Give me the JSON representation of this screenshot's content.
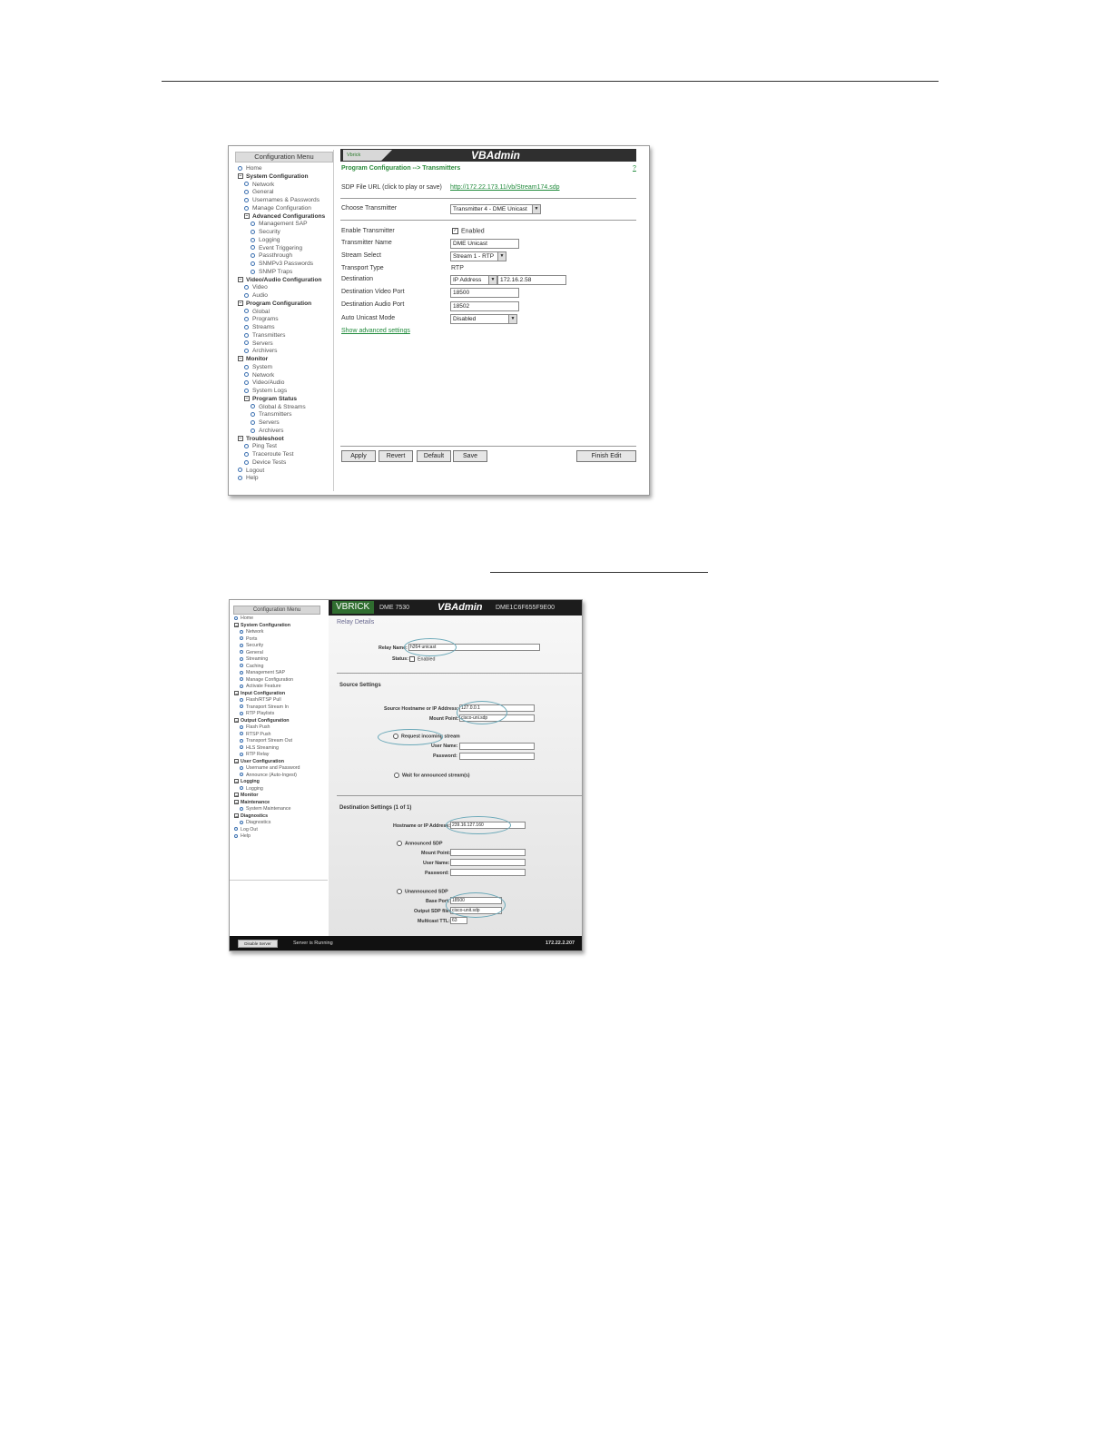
{
  "screen1": {
    "menu_title": "Configuration Menu",
    "menu": [
      {
        "label": "Home",
        "level": 0,
        "bold": false
      },
      {
        "label": "System Configuration",
        "level": 0,
        "bold": true
      },
      {
        "label": "Network",
        "level": 1,
        "bold": false
      },
      {
        "label": "General",
        "level": 1,
        "bold": false
      },
      {
        "label": "Usernames & Passwords",
        "level": 1,
        "bold": false
      },
      {
        "label": "Manage Configuration",
        "level": 1,
        "bold": false
      },
      {
        "label": "Advanced Configurations",
        "level": 1,
        "bold": true
      },
      {
        "label": "Management SAP",
        "level": 2,
        "bold": false
      },
      {
        "label": "Security",
        "level": 2,
        "bold": false
      },
      {
        "label": "Logging",
        "level": 2,
        "bold": false
      },
      {
        "label": "Event Triggering",
        "level": 2,
        "bold": false
      },
      {
        "label": "Passthrough",
        "level": 2,
        "bold": false
      },
      {
        "label": "SNMPv3 Passwords",
        "level": 2,
        "bold": false
      },
      {
        "label": "SNMP Traps",
        "level": 2,
        "bold": false
      },
      {
        "label": "Video/Audio Configuration",
        "level": 0,
        "bold": true
      },
      {
        "label": "Video",
        "level": 1,
        "bold": false
      },
      {
        "label": "Audio",
        "level": 1,
        "bold": false
      },
      {
        "label": "Program Configuration",
        "level": 0,
        "bold": true
      },
      {
        "label": "Global",
        "level": 1,
        "bold": false
      },
      {
        "label": "Programs",
        "level": 1,
        "bold": false
      },
      {
        "label": "Streams",
        "level": 1,
        "bold": false
      },
      {
        "label": "Transmitters",
        "level": 1,
        "bold": false
      },
      {
        "label": "Servers",
        "level": 1,
        "bold": false
      },
      {
        "label": "Archivers",
        "level": 1,
        "bold": false
      },
      {
        "label": "Monitor",
        "level": 0,
        "bold": true
      },
      {
        "label": "System",
        "level": 1,
        "bold": false
      },
      {
        "label": "Network",
        "level": 1,
        "bold": false
      },
      {
        "label": "Video/Audio",
        "level": 1,
        "bold": false
      },
      {
        "label": "System Logs",
        "level": 1,
        "bold": false
      },
      {
        "label": "Program Status",
        "level": 1,
        "bold": true
      },
      {
        "label": "Global & Streams",
        "level": 2,
        "bold": false
      },
      {
        "label": "Transmitters",
        "level": 2,
        "bold": false
      },
      {
        "label": "Servers",
        "level": 2,
        "bold": false
      },
      {
        "label": "Archivers",
        "level": 2,
        "bold": false
      },
      {
        "label": "Troubleshoot",
        "level": 0,
        "bold": true
      },
      {
        "label": "Ping Test",
        "level": 1,
        "bold": false
      },
      {
        "label": "Traceroute Test",
        "level": 1,
        "bold": false
      },
      {
        "label": "Device Tests",
        "level": 1,
        "bold": false
      },
      {
        "label": "Logout",
        "level": 0,
        "bold": false
      },
      {
        "label": "Help",
        "level": 0,
        "bold": false
      }
    ],
    "banner_logo": "Vbrick",
    "banner_title": "VBAdmin",
    "breadcrumb": "Program Configuration --> Transmitters",
    "help_link": "?",
    "sdp_label": "SDP File URL (click to play or save)",
    "sdp_url": "http://172.22.173.11/vb/Stream174.sdp",
    "choose_label": "Choose Transmitter",
    "choose_value": "Transmitter 4 - DME Unicast",
    "fields": {
      "enable_label": "Enable Transmitter",
      "enable_value": "Enabled",
      "name_label": "Transmitter Name",
      "name_value": "DME Unicast",
      "stream_label": "Stream Select",
      "stream_value": "Stream 1 - RTP",
      "transport_label": "Transport Type",
      "transport_value": "RTP",
      "dest_label": "Destination",
      "dest_type": "IP Address",
      "dest_ip": "172.16.2.58",
      "video_port_label": "Destination Video Port",
      "video_port_value": "18500",
      "audio_port_label": "Destination Audio Port",
      "audio_port_value": "18502",
      "unicast_label": "Auto Unicast Mode",
      "unicast_value": "Disabled",
      "advanced_link": "Show advanced settings"
    },
    "buttons": {
      "apply": "Apply",
      "revert": "Revert",
      "default": "Default",
      "save": "Save",
      "finish": "Finish Edit"
    }
  },
  "screen2": {
    "menu_title": "Configuration Menu",
    "menu": [
      {
        "label": "Home",
        "level": 0,
        "bold": false
      },
      {
        "label": "System Configuration",
        "level": 0,
        "bold": true
      },
      {
        "label": "Network",
        "level": 1,
        "bold": false
      },
      {
        "label": "Ports",
        "level": 1,
        "bold": false
      },
      {
        "label": "Security",
        "level": 1,
        "bold": false
      },
      {
        "label": "General",
        "level": 1,
        "bold": false
      },
      {
        "label": "Streaming",
        "level": 1,
        "bold": false
      },
      {
        "label": "Caching",
        "level": 1,
        "bold": false
      },
      {
        "label": "Management SAP",
        "level": 1,
        "bold": false
      },
      {
        "label": "Manage Configuration",
        "level": 1,
        "bold": false
      },
      {
        "label": "Activate Feature",
        "level": 1,
        "bold": false
      },
      {
        "label": "Input Configuration",
        "level": 0,
        "bold": true
      },
      {
        "label": "Flash/RTSP Pull",
        "level": 1,
        "bold": false
      },
      {
        "label": "Transport Stream In",
        "level": 1,
        "bold": false
      },
      {
        "label": "RTP Playlists",
        "level": 1,
        "bold": false
      },
      {
        "label": "Output Configuration",
        "level": 0,
        "bold": true
      },
      {
        "label": "Flash Push",
        "level": 1,
        "bold": false
      },
      {
        "label": "RTSP Push",
        "level": 1,
        "bold": false
      },
      {
        "label": "Transport Stream Out",
        "level": 1,
        "bold": false
      },
      {
        "label": "HLS Streaming",
        "level": 1,
        "bold": false
      },
      {
        "label": "RTP Relay",
        "level": 1,
        "bold": false
      },
      {
        "label": "User Configuration",
        "level": 0,
        "bold": true
      },
      {
        "label": "Username and Password",
        "level": 1,
        "bold": false
      },
      {
        "label": "Announce (Auto-Ingest)",
        "level": 1,
        "bold": false
      },
      {
        "label": "Logging",
        "level": 0,
        "bold": true
      },
      {
        "label": "Logging",
        "level": 1,
        "bold": false
      },
      {
        "label": "Monitor",
        "level": 0,
        "bold": true
      },
      {
        "label": "Maintenance",
        "level": 0,
        "bold": true
      },
      {
        "label": "System Maintenance",
        "level": 1,
        "bold": false
      },
      {
        "label": "Diagnostics",
        "level": 0,
        "bold": true
      },
      {
        "label": "Diagnostics",
        "level": 1,
        "bold": false
      },
      {
        "label": "Log Out",
        "level": 0,
        "bold": false
      },
      {
        "label": "Help",
        "level": 0,
        "bold": false
      }
    ],
    "topbar": {
      "brand": "VBRICK",
      "model": "DME 7530",
      "title": "VBAdmin",
      "device_id": "DME1C6F655F9E00"
    },
    "section_title": "Relay Details",
    "relay_name_label": "Relay Name:",
    "relay_name_value": "h264 unicast",
    "status_label": "Status:",
    "status_value": "Enabled",
    "source_heading": "Source Settings",
    "source_host_label": "Source Hostname or IP Address:",
    "source_host_value": "127.0.0.1",
    "mount_label": "Mount Point:",
    "mount_value": "cisco-uni.sdp",
    "request_label": "Request incoming stream",
    "user_label": "User Name:",
    "password_label": "Password:",
    "wait_label": "Wait for announced stream(s)",
    "dest_heading": "Destination Settings (1 of 1)",
    "dest_host_label": "Hostname or IP Address:",
    "dest_host_value": "239.16.127.160",
    "announced_label": "Announced SDP",
    "ann_mount_label": "Mount Point:",
    "ann_user_label": "User Name:",
    "ann_password_label": "Password:",
    "unannounced_label": "Unannounced SDP",
    "base_port_label": "Base Port:",
    "base_port_value": "18500",
    "sdp_file_label": "Output SDP file:",
    "sdp_file_value": "cisco-unit.sdp",
    "ttl_label": "Multicast TTL:",
    "ttl_value": "63",
    "bottombar": {
      "button": "Disable Server",
      "status": "Server is Running",
      "ip": "172.22.2.207"
    }
  }
}
